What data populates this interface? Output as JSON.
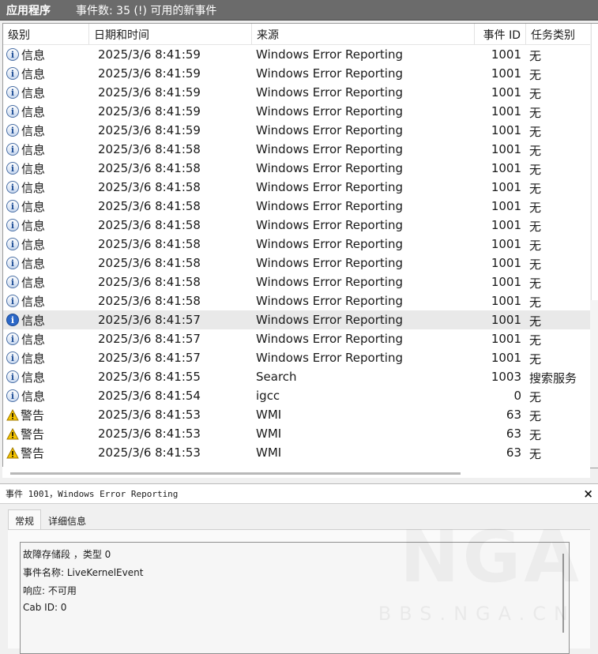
{
  "titlebar": {
    "app": "应用程序",
    "summary": "事件数: 35 (!) 可用的新事件"
  },
  "columns": {
    "level": "级别",
    "datetime": "日期和时间",
    "source": "来源",
    "event_id": "事件 ID",
    "task": "任务类别"
  },
  "rows": [
    {
      "level": "信息",
      "icon": "info-icon",
      "datetime": "2025/3/6 8:41:59",
      "source": "Windows Error Reporting",
      "id": "1001",
      "task": "无"
    },
    {
      "level": "信息",
      "icon": "info-icon",
      "datetime": "2025/3/6 8:41:59",
      "source": "Windows Error Reporting",
      "id": "1001",
      "task": "无"
    },
    {
      "level": "信息",
      "icon": "info-icon",
      "datetime": "2025/3/6 8:41:59",
      "source": "Windows Error Reporting",
      "id": "1001",
      "task": "无"
    },
    {
      "level": "信息",
      "icon": "info-icon",
      "datetime": "2025/3/6 8:41:59",
      "source": "Windows Error Reporting",
      "id": "1001",
      "task": "无"
    },
    {
      "level": "信息",
      "icon": "info-icon",
      "datetime": "2025/3/6 8:41:59",
      "source": "Windows Error Reporting",
      "id": "1001",
      "task": "无"
    },
    {
      "level": "信息",
      "icon": "info-icon",
      "datetime": "2025/3/6 8:41:58",
      "source": "Windows Error Reporting",
      "id": "1001",
      "task": "无"
    },
    {
      "level": "信息",
      "icon": "info-icon",
      "datetime": "2025/3/6 8:41:58",
      "source": "Windows Error Reporting",
      "id": "1001",
      "task": "无"
    },
    {
      "level": "信息",
      "icon": "info-icon",
      "datetime": "2025/3/6 8:41:58",
      "source": "Windows Error Reporting",
      "id": "1001",
      "task": "无"
    },
    {
      "level": "信息",
      "icon": "info-icon",
      "datetime": "2025/3/6 8:41:58",
      "source": "Windows Error Reporting",
      "id": "1001",
      "task": "无"
    },
    {
      "level": "信息",
      "icon": "info-icon",
      "datetime": "2025/3/6 8:41:58",
      "source": "Windows Error Reporting",
      "id": "1001",
      "task": "无"
    },
    {
      "level": "信息",
      "icon": "info-icon",
      "datetime": "2025/3/6 8:41:58",
      "source": "Windows Error Reporting",
      "id": "1001",
      "task": "无"
    },
    {
      "level": "信息",
      "icon": "info-icon",
      "datetime": "2025/3/6 8:41:58",
      "source": "Windows Error Reporting",
      "id": "1001",
      "task": "无"
    },
    {
      "level": "信息",
      "icon": "info-icon",
      "datetime": "2025/3/6 8:41:58",
      "source": "Windows Error Reporting",
      "id": "1001",
      "task": "无"
    },
    {
      "level": "信息",
      "icon": "info-icon",
      "datetime": "2025/3/6 8:41:58",
      "source": "Windows Error Reporting",
      "id": "1001",
      "task": "无"
    },
    {
      "level": "信息",
      "icon": "info-icon",
      "datetime": "2025/3/6 8:41:57",
      "source": "Windows Error Reporting",
      "id": "1001",
      "task": "无",
      "selected": true
    },
    {
      "level": "信息",
      "icon": "info-icon",
      "datetime": "2025/3/6 8:41:57",
      "source": "Windows Error Reporting",
      "id": "1001",
      "task": "无"
    },
    {
      "level": "信息",
      "icon": "info-icon",
      "datetime": "2025/3/6 8:41:57",
      "source": "Windows Error Reporting",
      "id": "1001",
      "task": "无"
    },
    {
      "level": "信息",
      "icon": "info-icon",
      "datetime": "2025/3/6 8:41:55",
      "source": "Search",
      "id": "1003",
      "task": "搜索服务"
    },
    {
      "level": "信息",
      "icon": "info-icon",
      "datetime": "2025/3/6 8:41:54",
      "source": "igcc",
      "id": "0",
      "task": "无"
    },
    {
      "level": "警告",
      "icon": "warning-icon",
      "datetime": "2025/3/6 8:41:53",
      "source": "WMI",
      "id": "63",
      "task": "无"
    },
    {
      "level": "警告",
      "icon": "warning-icon",
      "datetime": "2025/3/6 8:41:53",
      "source": "WMI",
      "id": "63",
      "task": "无"
    },
    {
      "level": "警告",
      "icon": "warning-icon",
      "datetime": "2025/3/6 8:41:53",
      "source": "WMI",
      "id": "63",
      "task": "无"
    }
  ],
  "detail": {
    "title": "事件 1001，Windows Error Reporting",
    "close": "×",
    "tabs": [
      "常规",
      "详细信息"
    ],
    "lines": [
      "故障存储段 ，类型 0",
      "事件名称: LiveKernelEvent",
      "响应: 不可用",
      "Cab ID: 0"
    ],
    "watermark": "NGA",
    "watermark_sub": "BBS.NGA.CN"
  }
}
